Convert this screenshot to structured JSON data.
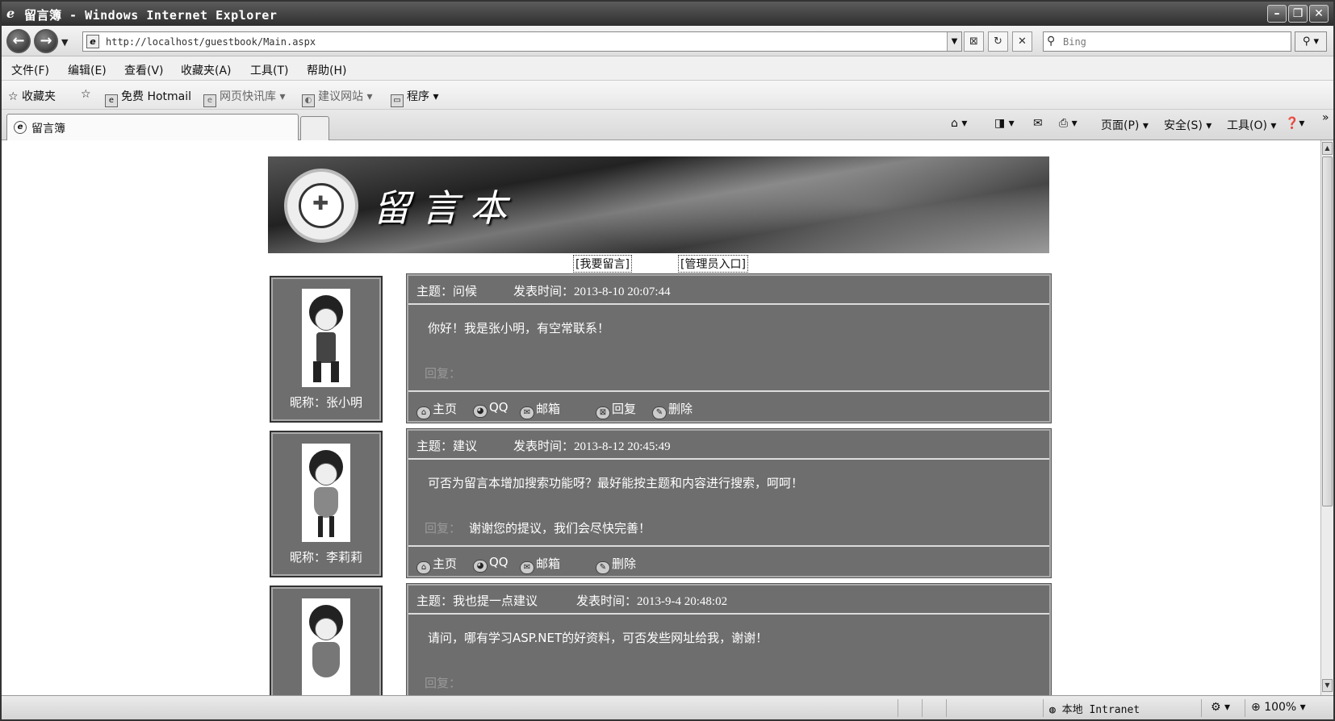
{
  "window": {
    "title": "留言簿 - Windows Internet Explorer",
    "logo": "e"
  },
  "address_bar": {
    "url": "http://localhost/guestbook/Main.aspx",
    "search_placeholder": "Bing"
  },
  "menu": [
    "文件(F)",
    "编辑(E)",
    "查看(V)",
    "收藏夹(A)",
    "工具(T)",
    "帮助(H)"
  ],
  "favorites_bar": {
    "favorites_label": "收藏夹",
    "items": [
      "免费 Hotmail",
      "网页快讯库 ▾",
      "建议网站 ▾",
      "程序 ▾"
    ]
  },
  "tab": {
    "label": "留言簿"
  },
  "command_bar": {
    "page": "页面(P) ▾",
    "safety": "安全(S) ▾",
    "tools": "工具(O) ▾",
    "help": "❓▾",
    "more": "»"
  },
  "page": {
    "banner_title": "留言本",
    "links": {
      "post": "[我要留言]",
      "admin": "[管理员入口]"
    },
    "labels": {
      "subject_prefix": "主题：",
      "time_prefix": "发表时间：",
      "reply_label": "回复：",
      "home": "主页",
      "qq": "QQ",
      "mail": "邮箱",
      "reply": "回复",
      "delete": "删除"
    },
    "posts": [
      {
        "nickname": "昵称：张小明",
        "subject": "问候",
        "time": "2013-8-10 20:07:44",
        "content": "你好！我是张小明，有空常联系！",
        "reply": ""
      },
      {
        "nickname": "昵称：李莉莉",
        "subject": "建议",
        "time": "2013-8-12 20:45:49",
        "content": "可否为留言本增加搜索功能呀？最好能按主题和内容进行搜索，呵呵！",
        "reply": "谢谢您的提议，我们会尽快完善！"
      },
      {
        "nickname": "",
        "subject": "我也提一点建议",
        "time": "2013-9-4 20:48:02",
        "content": "请问，哪有学习ASP.NET的好资料，可否发些网址给我，谢谢！",
        "reply": ""
      }
    ]
  },
  "status_bar": {
    "zone": "本地 Intranet",
    "zoom": "100%"
  }
}
